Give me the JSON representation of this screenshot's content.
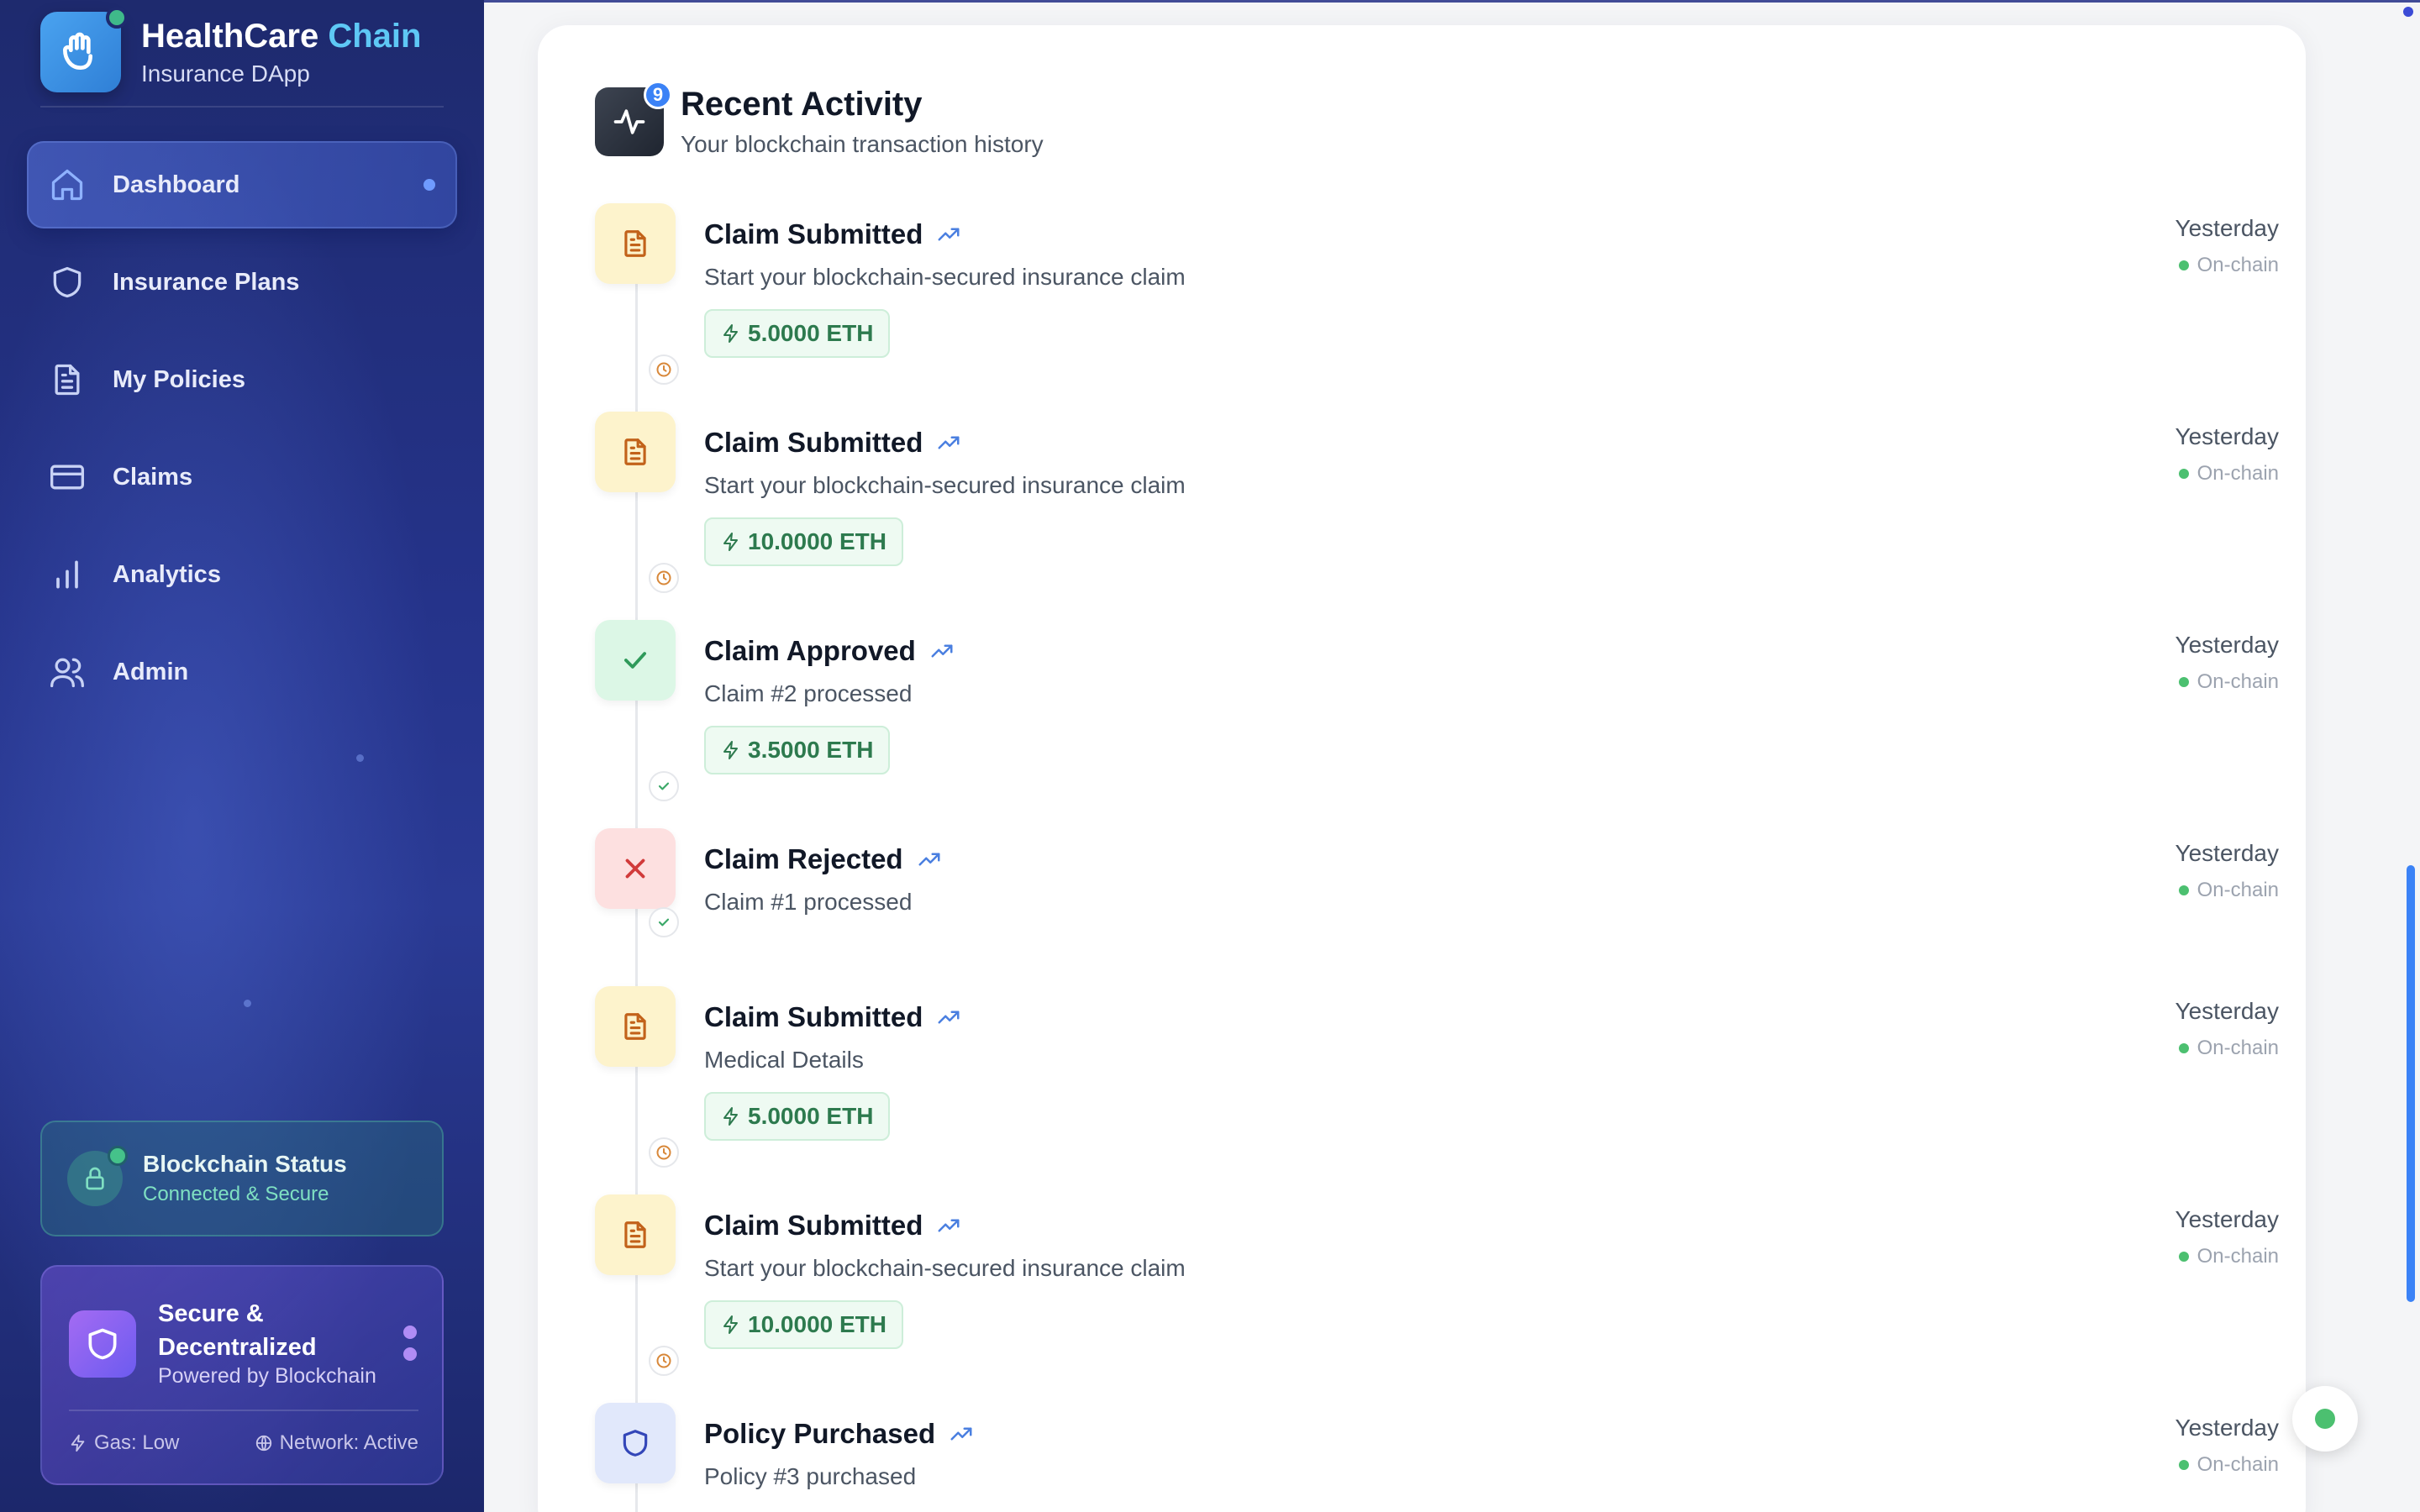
{
  "brand": {
    "title_main": "HealthCare",
    "title_accent": "Chain",
    "subtitle": "Insurance DApp"
  },
  "nav": {
    "items": [
      {
        "label": "Dashboard",
        "icon": "home-icon",
        "active": true
      },
      {
        "label": "Insurance Plans",
        "icon": "shield-icon"
      },
      {
        "label": "My Policies",
        "icon": "document-icon"
      },
      {
        "label": "Claims",
        "icon": "credit-card-icon"
      },
      {
        "label": "Analytics",
        "icon": "bar-chart-icon"
      },
      {
        "label": "Admin",
        "icon": "users-icon"
      }
    ]
  },
  "blockchain_status": {
    "title": "Blockchain Status",
    "subtitle": "Connected & Secure"
  },
  "secure_card": {
    "title": "Secure & Decentralized",
    "subtitle": "Powered by Blockchain",
    "gas": "Gas: Low",
    "network": "Network: Active"
  },
  "activity": {
    "title": "Recent Activity",
    "subtitle": "Your blockchain transaction history",
    "badge": "9",
    "items": [
      {
        "title": "Claim Submitted",
        "desc": "Start your blockchain-secured insurance claim",
        "amount": "5.0000 ETH",
        "time": "Yesterday",
        "chain": "On-chain",
        "kind": "submitted"
      },
      {
        "title": "Claim Submitted",
        "desc": "Start your blockchain-secured insurance claim",
        "amount": "10.0000 ETH",
        "time": "Yesterday",
        "chain": "On-chain",
        "kind": "submitted"
      },
      {
        "title": "Claim Approved",
        "desc": "Claim #2 processed",
        "amount": "3.5000 ETH",
        "time": "Yesterday",
        "chain": "On-chain",
        "kind": "approved"
      },
      {
        "title": "Claim Rejected",
        "desc": "Claim #1 processed",
        "time": "Yesterday",
        "chain": "On-chain",
        "kind": "rejected"
      },
      {
        "title": "Claim Submitted",
        "desc": "Medical Details",
        "amount": "5.0000 ETH",
        "time": "Yesterday",
        "chain": "On-chain",
        "kind": "submitted"
      },
      {
        "title": "Claim Submitted",
        "desc": "Start your blockchain-secured insurance claim",
        "amount": "10.0000 ETH",
        "time": "Yesterday",
        "chain": "On-chain",
        "kind": "submitted"
      },
      {
        "title": "Policy Purchased",
        "desc": "Policy #3 purchased",
        "time": "Yesterday",
        "chain": "On-chain",
        "kind": "policy"
      }
    ]
  },
  "colors": {
    "accent": "#5ec8f5",
    "sidebar": "#25338a",
    "success": "#4cc070",
    "amount_text": "#2d7a4e"
  }
}
